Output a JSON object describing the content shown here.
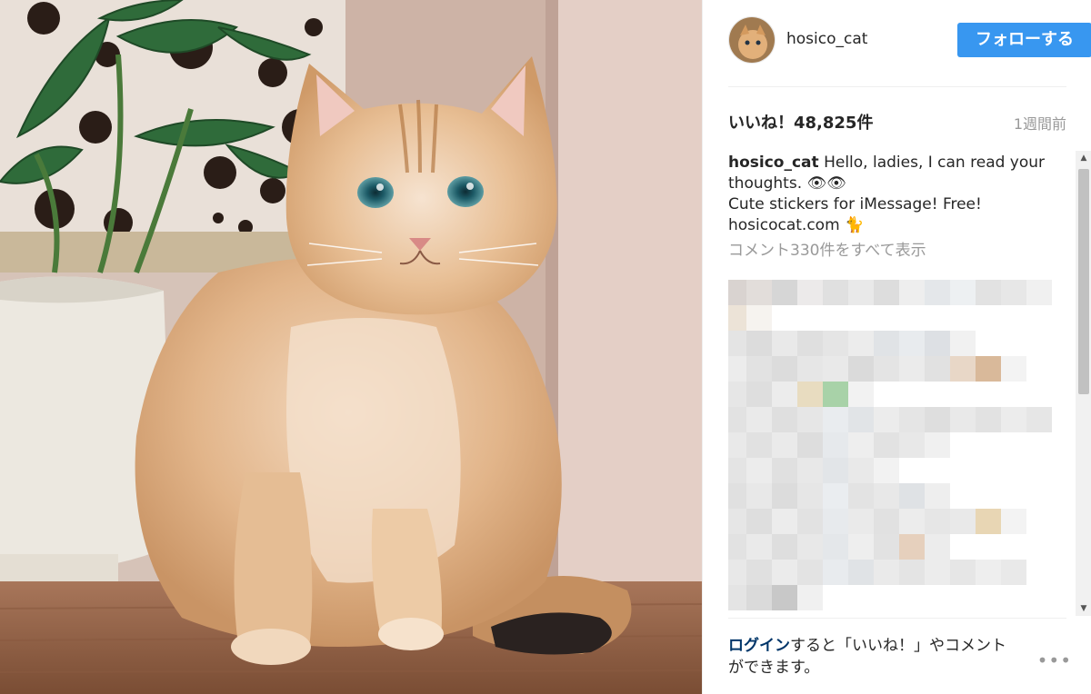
{
  "post": {
    "author": {
      "username": "hosico_cat"
    },
    "follow_button": "フォローする",
    "likes_label": "いいね！48,825件",
    "time_ago": "1週間前",
    "caption": {
      "username": "hosico_cat",
      "lines": [
        "Hello, ladies, I can read your",
        "thoughts. 👁👁",
        "Cute stickers for iMessage! Free!",
        "hosicocat.com 🐈"
      ]
    },
    "view_all_comments": "コメント330件をすべて表示",
    "login_prompt": {
      "link": "ログイン",
      "rest": "すると「いいね！」やコメントができます。"
    }
  },
  "icons": {
    "more": "more-options-icon",
    "scroll_up": "scroll-up-arrow-icon",
    "scroll_down": "scroll-down-arrow-icon"
  },
  "colors": {
    "follow_button": "#3897f0",
    "link": "#003569",
    "muted_text": "#999999"
  }
}
